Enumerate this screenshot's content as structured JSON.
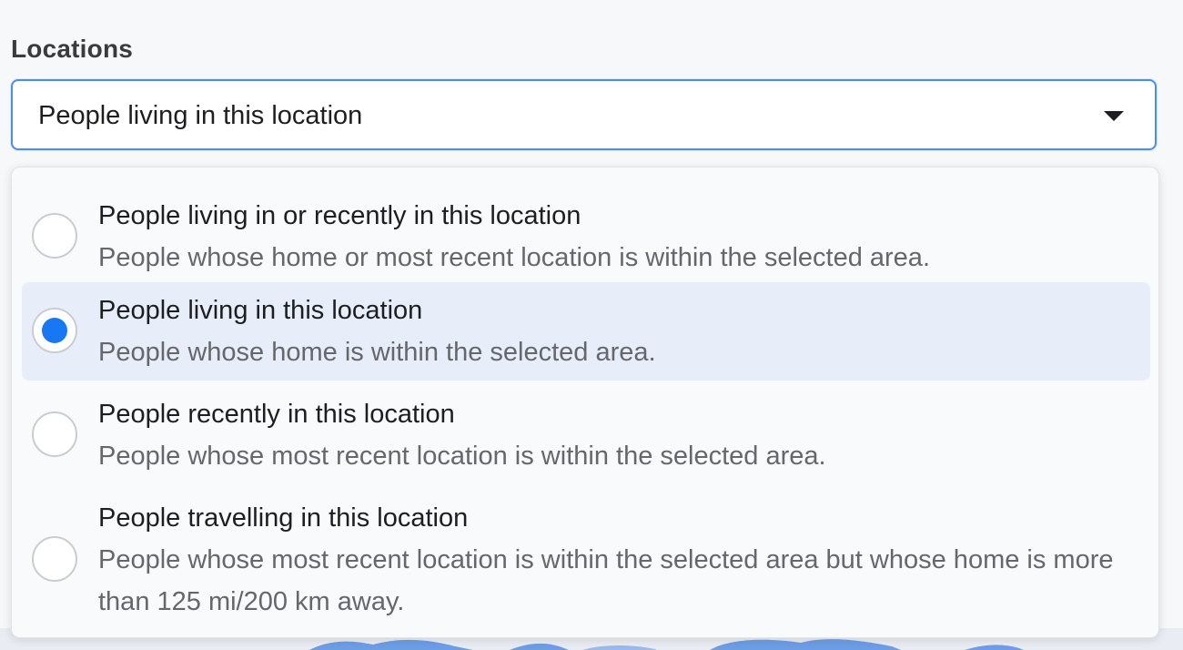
{
  "locations": {
    "label": "Locations",
    "selected_value": "People living in this location",
    "options": [
      {
        "title": "People living in or recently in this location",
        "description": "People whose home or most recent location is within the selected area.",
        "selected": false
      },
      {
        "title": "People living in this location",
        "description": "People whose home is within the selected area.",
        "selected": true
      },
      {
        "title": "People recently in this location",
        "description": "People whose most recent location is within the selected area.",
        "selected": false
      },
      {
        "title": "People travelling in this location",
        "description": "People whose most recent location is within the selected area but whose home is more than 125 mi/200 km away.",
        "selected": false
      }
    ]
  },
  "colors": {
    "accent": "#1877f2",
    "focus_border": "#4c8ee9",
    "selected_row": "#e7eefa",
    "secondary_text": "#65676b"
  },
  "icons": {
    "dropdown": "caret-down-icon",
    "radio_selected": "radio-selected-icon",
    "radio_unselected": "radio-unselected-icon"
  }
}
